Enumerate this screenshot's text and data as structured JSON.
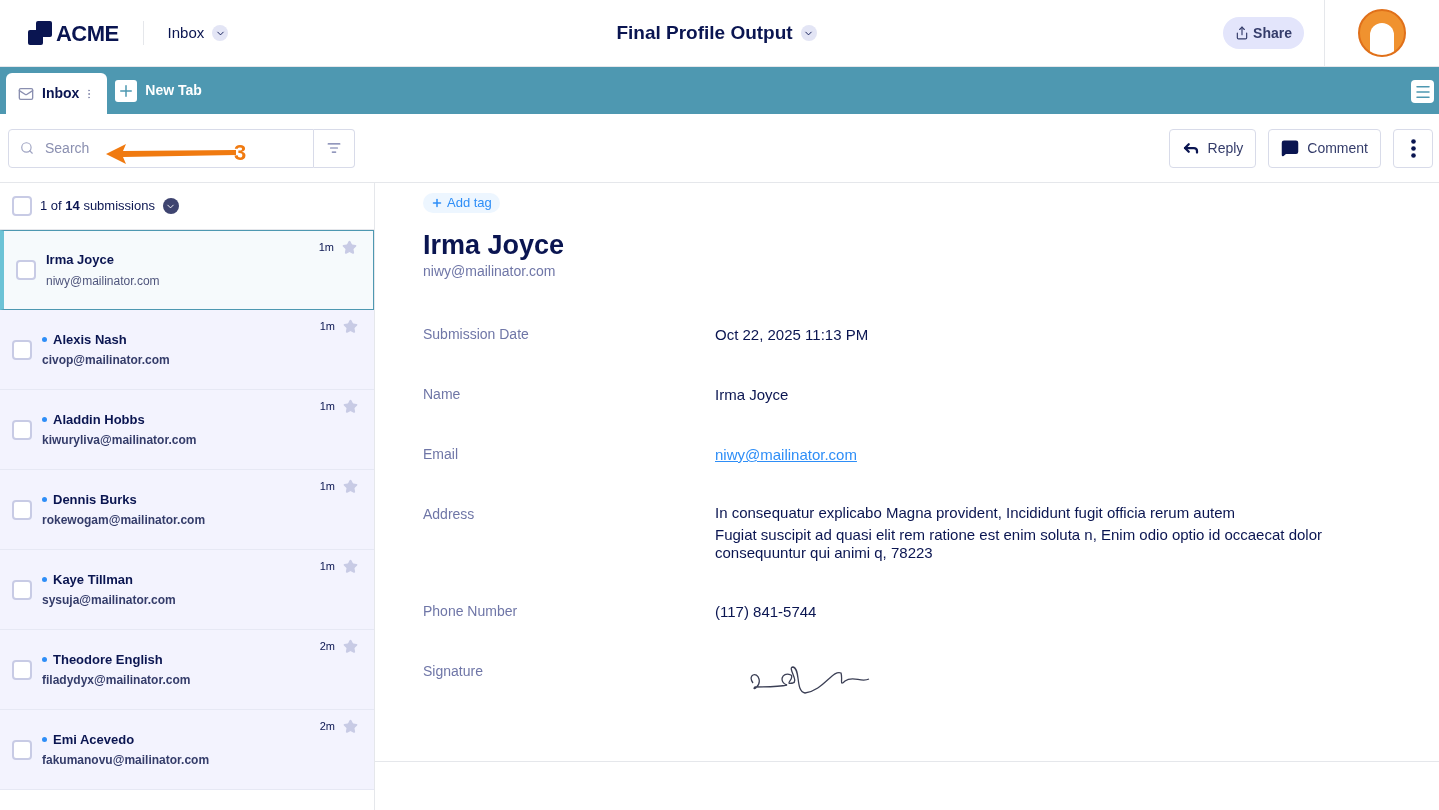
{
  "header": {
    "logo": "ACME",
    "section": "Inbox",
    "title": "Final Profile Output",
    "share": "Share"
  },
  "tabs": [
    {
      "label": "Inbox",
      "selected": true
    }
  ],
  "new_tab": "New Tab",
  "search": {
    "placeholder": "Search"
  },
  "annotation": {
    "label": "3"
  },
  "actions": [
    "Reply",
    "Comment"
  ],
  "list_header": {
    "count": "1 of **14** submissions",
    "checked": false
  },
  "submissions": [
    {
      "name": "Irma Joyce",
      "email": "niwy@mailinator.com",
      "time": "1m",
      "selected": true,
      "unread": false,
      "checked": false,
      "starred": false
    },
    {
      "name": "Alexis Nash",
      "email": "civop@mailinator.com",
      "time": "1m",
      "selected": false,
      "unread": true,
      "checked": false,
      "starred": false
    },
    {
      "name": "Aladdin Hobbs",
      "email": "kiwuryliva@mailinator.com",
      "time": "1m",
      "selected": false,
      "unread": true,
      "checked": false,
      "starred": false
    },
    {
      "name": "Dennis Burks",
      "email": "rokewogam@mailinator.com",
      "time": "1m",
      "selected": false,
      "unread": true,
      "checked": false,
      "starred": false
    },
    {
      "name": "Kaye Tillman",
      "email": "sysuja@mailinator.com",
      "time": "1m",
      "selected": false,
      "unread": true,
      "checked": false,
      "starred": false
    },
    {
      "name": "Theodore English",
      "email": "filadydyx@mailinator.com",
      "time": "2m",
      "selected": false,
      "unread": true,
      "checked": false,
      "starred": false
    },
    {
      "name": "Emi Acevedo",
      "email": "fakumanovu@mailinator.com",
      "time": "2m",
      "selected": false,
      "unread": true,
      "checked": false,
      "starred": false
    }
  ],
  "detail": {
    "add_tag": "Add tag",
    "name": "Irma Joyce",
    "email": "niwy@mailinator.com",
    "fields": [
      {
        "kind": "text",
        "label": "Submission Date",
        "value": "Oct 22, 2025 11:13 PM"
      },
      {
        "kind": "text",
        "label": "Name",
        "value": "Irma Joyce"
      },
      {
        "kind": "link",
        "label": "Email",
        "value": "niwy@mailinator.com"
      },
      {
        "kind": "lines",
        "label": "Address",
        "lines": [
          "In consequatur explicabo Magna provident, Incididunt fugit officia rerum autem",
          "Fugiat suscipit ad quasi elit rem ratione est enim soluta n, Enim odio optio id occaecat dolor consequuntur qui animi q, 78223"
        ]
      },
      {
        "kind": "text",
        "label": "Phone Number",
        "value": "(117) 841-5744"
      },
      {
        "kind": "signature",
        "label": "Signature"
      }
    ]
  }
}
